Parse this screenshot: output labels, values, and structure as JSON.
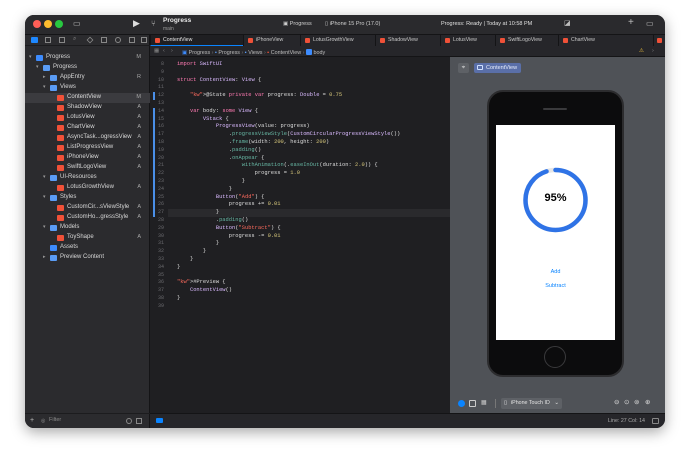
{
  "window": {
    "project": "Progress",
    "branch": "main",
    "scheme": "Progress",
    "device": "iPhone 15 Pro (17.0)",
    "status": "Progress: Ready | Today at 10:58 PM"
  },
  "tabs": [
    {
      "label": "ContentView"
    },
    {
      "label": "iPhoneView"
    },
    {
      "label": "LotusGrowthView"
    },
    {
      "label": "ShadowView"
    },
    {
      "label": "LotusView"
    },
    {
      "label": "SwiftLogoView"
    },
    {
      "label": "ChartView"
    }
  ],
  "breadcrumb": [
    "Progress",
    "Progress",
    "Views",
    "ContentView",
    "body"
  ],
  "navigator": [
    {
      "label": "Progress",
      "status": "M"
    },
    {
      "label": "Progress",
      "status": ""
    },
    {
      "label": "AppEntry",
      "status": "R"
    },
    {
      "label": "Views",
      "status": ""
    },
    {
      "label": "ContentView",
      "status": "M"
    },
    {
      "label": "ShadowView",
      "status": "A"
    },
    {
      "label": "LotusView",
      "status": "A"
    },
    {
      "label": "ChartView",
      "status": "A"
    },
    {
      "label": "AsyncTask...ogressView",
      "status": "A"
    },
    {
      "label": "ListProgressView",
      "status": "A"
    },
    {
      "label": "iPhoneView",
      "status": "A"
    },
    {
      "label": "SwiftLogoView",
      "status": "A"
    },
    {
      "label": "UI-Resources",
      "status": ""
    },
    {
      "label": "LotusGrowthView",
      "status": "A"
    },
    {
      "label": "Styles",
      "status": ""
    },
    {
      "label": "CustomCir...sViewStyle",
      "status": "A"
    },
    {
      "label": "CustomHo...gressStyle",
      "status": "A"
    },
    {
      "label": "Models",
      "status": ""
    },
    {
      "label": "ToyShape",
      "status": "A"
    },
    {
      "label": "Assets",
      "status": ""
    },
    {
      "label": "Preview Content",
      "status": ""
    }
  ],
  "filter_placeholder": "Filter",
  "line_numbers": [
    "8",
    "9",
    "10",
    "11",
    "12",
    "13",
    "14",
    "15",
    "16",
    "17",
    "18",
    "19",
    "20",
    "21",
    "22",
    "23",
    "24",
    "25",
    "26",
    "27",
    "28",
    "29",
    "30",
    "31",
    "32",
    "33",
    "34",
    "35",
    "36",
    "37",
    "38",
    "39"
  ],
  "code": [
    "import SwiftUI",
    "",
    "struct ContentView: View {",
    "",
    "    @State private var progress: Double = 0.75",
    "",
    "    var body: some View {",
    "        VStack {",
    "            ProgressView(value: progress)",
    "                .progressViewStyle(CustomCircularProgressViewStyle())",
    "                .frame(width: 200, height: 200)",
    "                .padding()",
    "                .onAppear {",
    "                    withAnimation(.easeInOut(duration: 2.0)) {",
    "                        progress = 1.0",
    "                    }",
    "                }",
    "            Button(\"Add\") {",
    "                progress += 0.01",
    "            }",
    "            .padding()",
    "            Button(\"Subtract\") {",
    "                progress -= 0.01",
    "            }",
    "        }",
    "    }",
    "}",
    "",
    "#Preview {",
    "    ContentView()",
    "}",
    ""
  ],
  "preview": {
    "pin_icon": "pin-icon",
    "chip": "ContentView",
    "progress_label": "95%",
    "progress_fraction": 0.95,
    "add_label": "Add",
    "subtract_label": "Subtract",
    "device_menu": "iPhone Touch ID"
  },
  "statusbar": {
    "cursor": "Line: 27  Col: 14"
  },
  "colors": {
    "accent": "#0a84ff",
    "ring": "#2f73e6",
    "ring_track": "#e6e6e6"
  }
}
